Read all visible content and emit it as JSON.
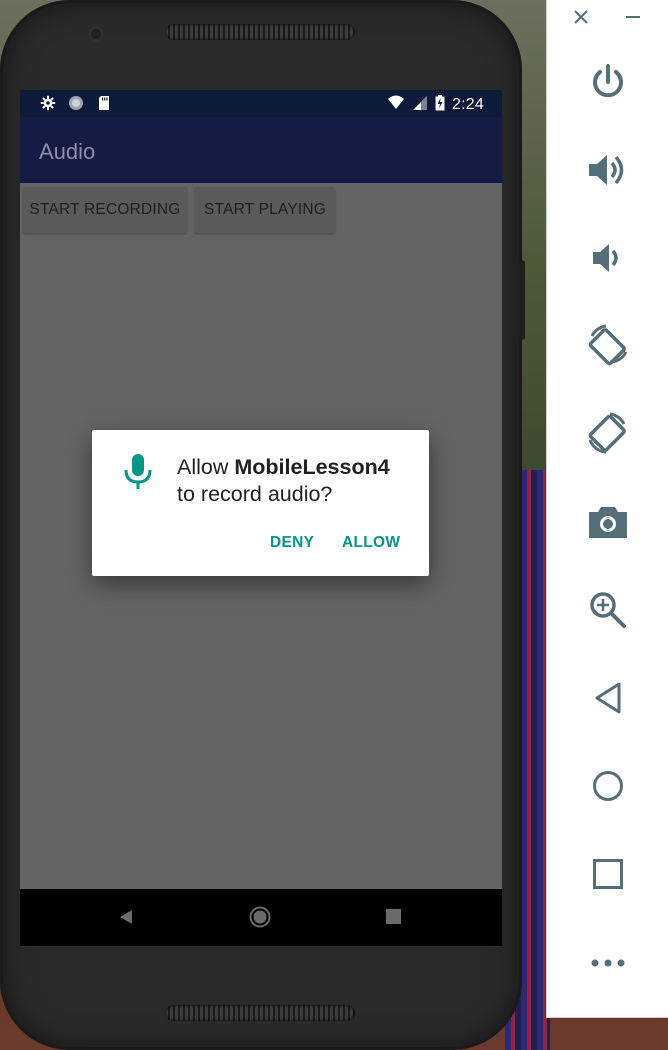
{
  "status_bar": {
    "time": "2:24",
    "icons": [
      "settings-icon",
      "sync-icon",
      "sd-card-icon",
      "wifi-icon",
      "signal-icon",
      "battery-icon"
    ]
  },
  "app": {
    "title": "Audio",
    "buttons": {
      "start_recording": "START RECORDING",
      "start_playing": "START PLAYING"
    }
  },
  "dialog": {
    "icon": "microphone-icon",
    "line1_prefix": "Allow ",
    "app_name": "MobileLesson4",
    "line2": "to record audio?",
    "deny": "DENY",
    "allow": "ALLOW"
  },
  "nav_bar": {
    "icons": [
      "back-icon",
      "home-icon",
      "recents-icon"
    ]
  },
  "emulator_panel": {
    "window_controls": [
      "close-icon",
      "minimize-icon"
    ],
    "buttons": [
      "power-icon",
      "volume-up-icon",
      "volume-down-icon",
      "rotate-left-icon",
      "rotate-right-icon",
      "camera-icon",
      "zoom-icon",
      "back-icon",
      "home-icon",
      "overview-icon",
      "more-icon"
    ]
  },
  "colors": {
    "accent": "#009688",
    "status_bar": "#0e1a3a",
    "app_bar": "#141c46",
    "scrim_screen": "#646464",
    "emulator_icon": "#546e7a"
  }
}
